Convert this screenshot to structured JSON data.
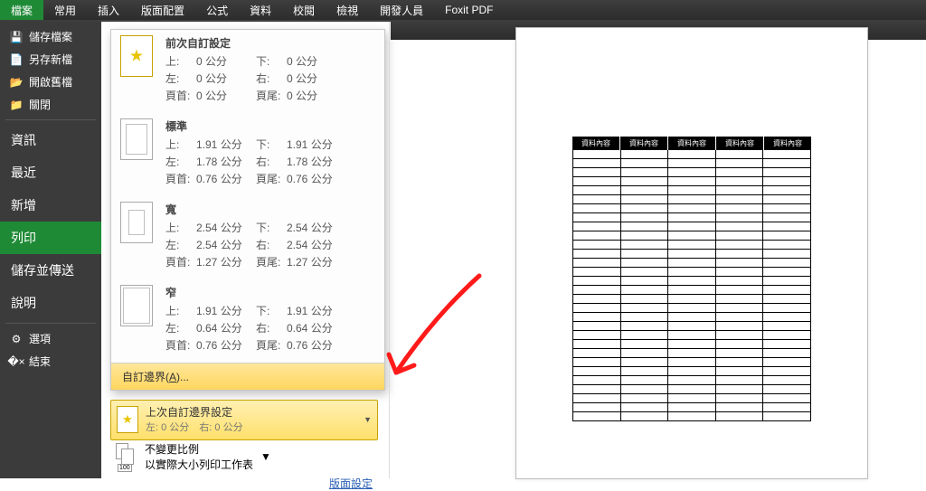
{
  "ribbon": {
    "tabs": [
      "檔案",
      "常用",
      "插入",
      "版面配置",
      "公式",
      "資料",
      "校閱",
      "檢視",
      "開發人員",
      "Foxit PDF"
    ],
    "active_index": 0
  },
  "sidebar": {
    "quick": [
      {
        "icon": "💾",
        "label": "儲存檔案"
      },
      {
        "icon": "📄",
        "label": "另存新檔"
      },
      {
        "icon": "📂",
        "label": "開啟舊檔"
      },
      {
        "icon": "📁",
        "label": "關閉"
      }
    ],
    "main": [
      {
        "label": "資訊"
      },
      {
        "label": "最近"
      },
      {
        "label": "新增"
      },
      {
        "label": "列印"
      },
      {
        "label": "儲存並傳送"
      },
      {
        "label": "說明"
      }
    ],
    "active_main": 3,
    "footer": [
      {
        "icon": "⚙",
        "label": "選項"
      },
      {
        "icon": "�×",
        "label": "結束"
      }
    ]
  },
  "margins": {
    "options": [
      {
        "kind": "last-custom",
        "title": "前次自訂設定",
        "rows": [
          [
            "上:",
            "0 公分",
            "下:",
            "0 公分"
          ],
          [
            "左:",
            "0 公分",
            "右:",
            "0 公分"
          ],
          [
            "頁首:",
            "0 公分",
            "頁尾:",
            "0 公分"
          ]
        ]
      },
      {
        "kind": "normal",
        "title": "標準",
        "rows": [
          [
            "上:",
            "1.91 公分",
            "下:",
            "1.91 公分"
          ],
          [
            "左:",
            "1.78 公分",
            "右:",
            "1.78 公分"
          ],
          [
            "頁首:",
            "0.76 公分",
            "頁尾:",
            "0.76 公分"
          ]
        ]
      },
      {
        "kind": "wide",
        "title": "寬",
        "rows": [
          [
            "上:",
            "2.54 公分",
            "下:",
            "2.54 公分"
          ],
          [
            "左:",
            "2.54 公分",
            "右:",
            "2.54 公分"
          ],
          [
            "頁首:",
            "1.27 公分",
            "頁尾:",
            "1.27 公分"
          ]
        ]
      },
      {
        "kind": "narrow",
        "title": "窄",
        "rows": [
          [
            "上:",
            "1.91 公分",
            "下:",
            "1.91 公分"
          ],
          [
            "左:",
            "0.64 公分",
            "右:",
            "0.64 公分"
          ],
          [
            "頁首:",
            "0.76 公分",
            "頁尾:",
            "0.76 公分"
          ]
        ]
      }
    ],
    "custom_label": "自訂邊界(A)..."
  },
  "selected_option": {
    "title": "上次自訂邊界設定",
    "sub": "左: 0 公分　右: 0 公分"
  },
  "scaling_option": {
    "title": "不變更比例",
    "sub": "以實際大小列印工作表"
  },
  "page_setup_link": "版面設定",
  "preview": {
    "headers": [
      "資料內容",
      "資料內容",
      "資料內容",
      "資料內容",
      "資料內容"
    ],
    "row_count": 30
  }
}
